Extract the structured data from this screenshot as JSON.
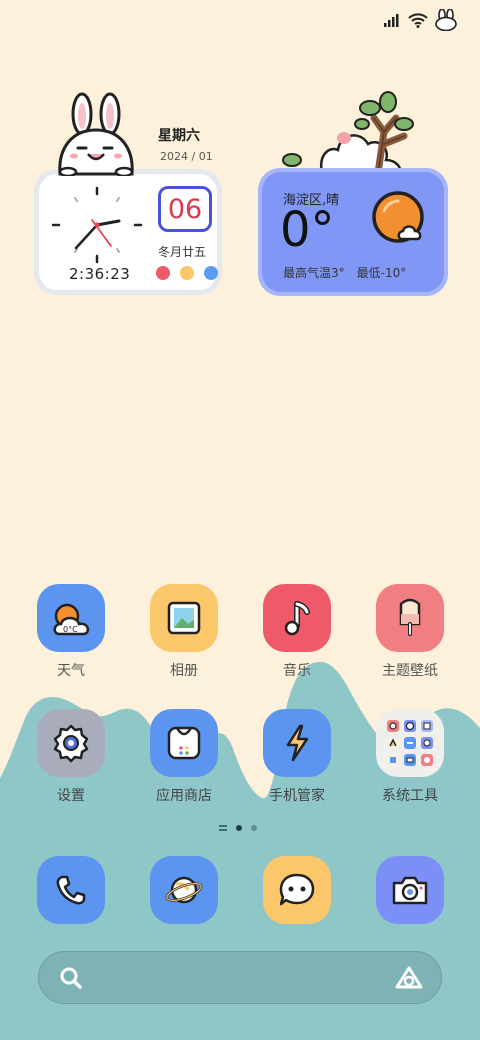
{
  "status_bar": {
    "signal": "signal-icon",
    "wifi": "wifi-icon",
    "extra": "rabbit-icon"
  },
  "clock_widget": {
    "day": "星期六",
    "date": "2024 / 01",
    "time": "2:36:23",
    "day_number": "06",
    "lunar": "冬月廿五",
    "dot_colors": [
      "#ee5a6a",
      "#fbc76b",
      "#5b9cf0"
    ]
  },
  "weather_widget": {
    "location": "海淀区,晴",
    "temperature": "0°",
    "high": "最高气温3°",
    "low": "最低-10°"
  },
  "apps_row1": [
    {
      "label": "天气",
      "icon": "weather-app-icon",
      "bg": "#5b95ef"
    },
    {
      "label": "相册",
      "icon": "gallery-app-icon",
      "bg": "#fcc66a"
    },
    {
      "label": "音乐",
      "icon": "music-app-icon",
      "bg": "#ef5a6a"
    },
    {
      "label": "主题壁纸",
      "icon": "themes-app-icon",
      "bg": "#f07e83"
    }
  ],
  "apps_row2": [
    {
      "label": "设置",
      "icon": "settings-app-icon",
      "bg": "#a9adbb"
    },
    {
      "label": "应用商店",
      "icon": "app-store-icon",
      "bg": "#5b95ef"
    },
    {
      "label": "手机管家",
      "icon": "phone-manager-icon",
      "bg": "#5b95ef"
    },
    {
      "label": "系统工具",
      "icon": "system-tools-folder-icon",
      "bg": "#f0efec"
    }
  ],
  "dock": [
    {
      "icon": "phone-icon",
      "bg": "#5b95ef"
    },
    {
      "icon": "browser-icon",
      "bg": "#5b95ef"
    },
    {
      "icon": "messages-icon",
      "bg": "#fcc66a"
    },
    {
      "icon": "camera-icon",
      "bg": "#7c8ff6"
    }
  ],
  "search": {
    "icon": "search-icon",
    "assistant": "assistant-icon"
  },
  "colors": {
    "background": "#fdf1db",
    "hills": "#8fc7c9"
  }
}
